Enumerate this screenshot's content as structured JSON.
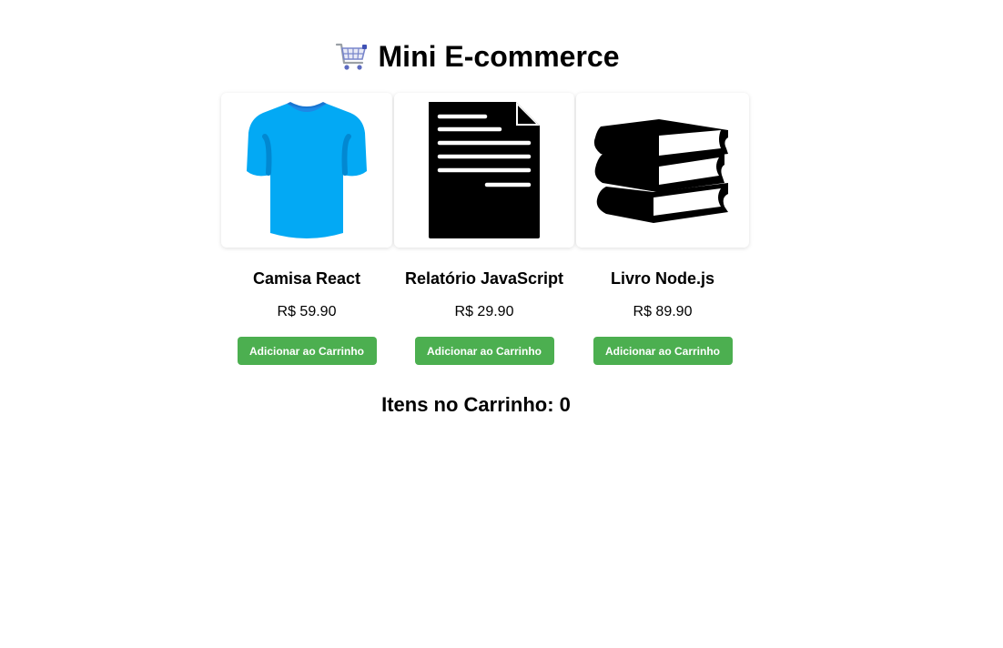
{
  "header": {
    "icon": "shopping-cart-icon",
    "title": "Mini E-commerce"
  },
  "products": [
    {
      "name": "Camisa React",
      "price": "R$ 59.90",
      "icon": "tshirt-icon",
      "button_label": "Adicionar ao Carrinho"
    },
    {
      "name": "Relatório JavaScript",
      "price": "R$ 29.90",
      "icon": "document-icon",
      "button_label": "Adicionar ao Carrinho"
    },
    {
      "name": "Livro Node.js",
      "price": "R$ 89.90",
      "icon": "books-icon",
      "button_label": "Adicionar ao Carrinho"
    }
  ],
  "cart": {
    "label": "Itens no Carrinho: 0"
  },
  "colors": {
    "button": "#4caf50",
    "tshirt": "#03a9f4",
    "tshirt_shade": "#1976d2"
  }
}
